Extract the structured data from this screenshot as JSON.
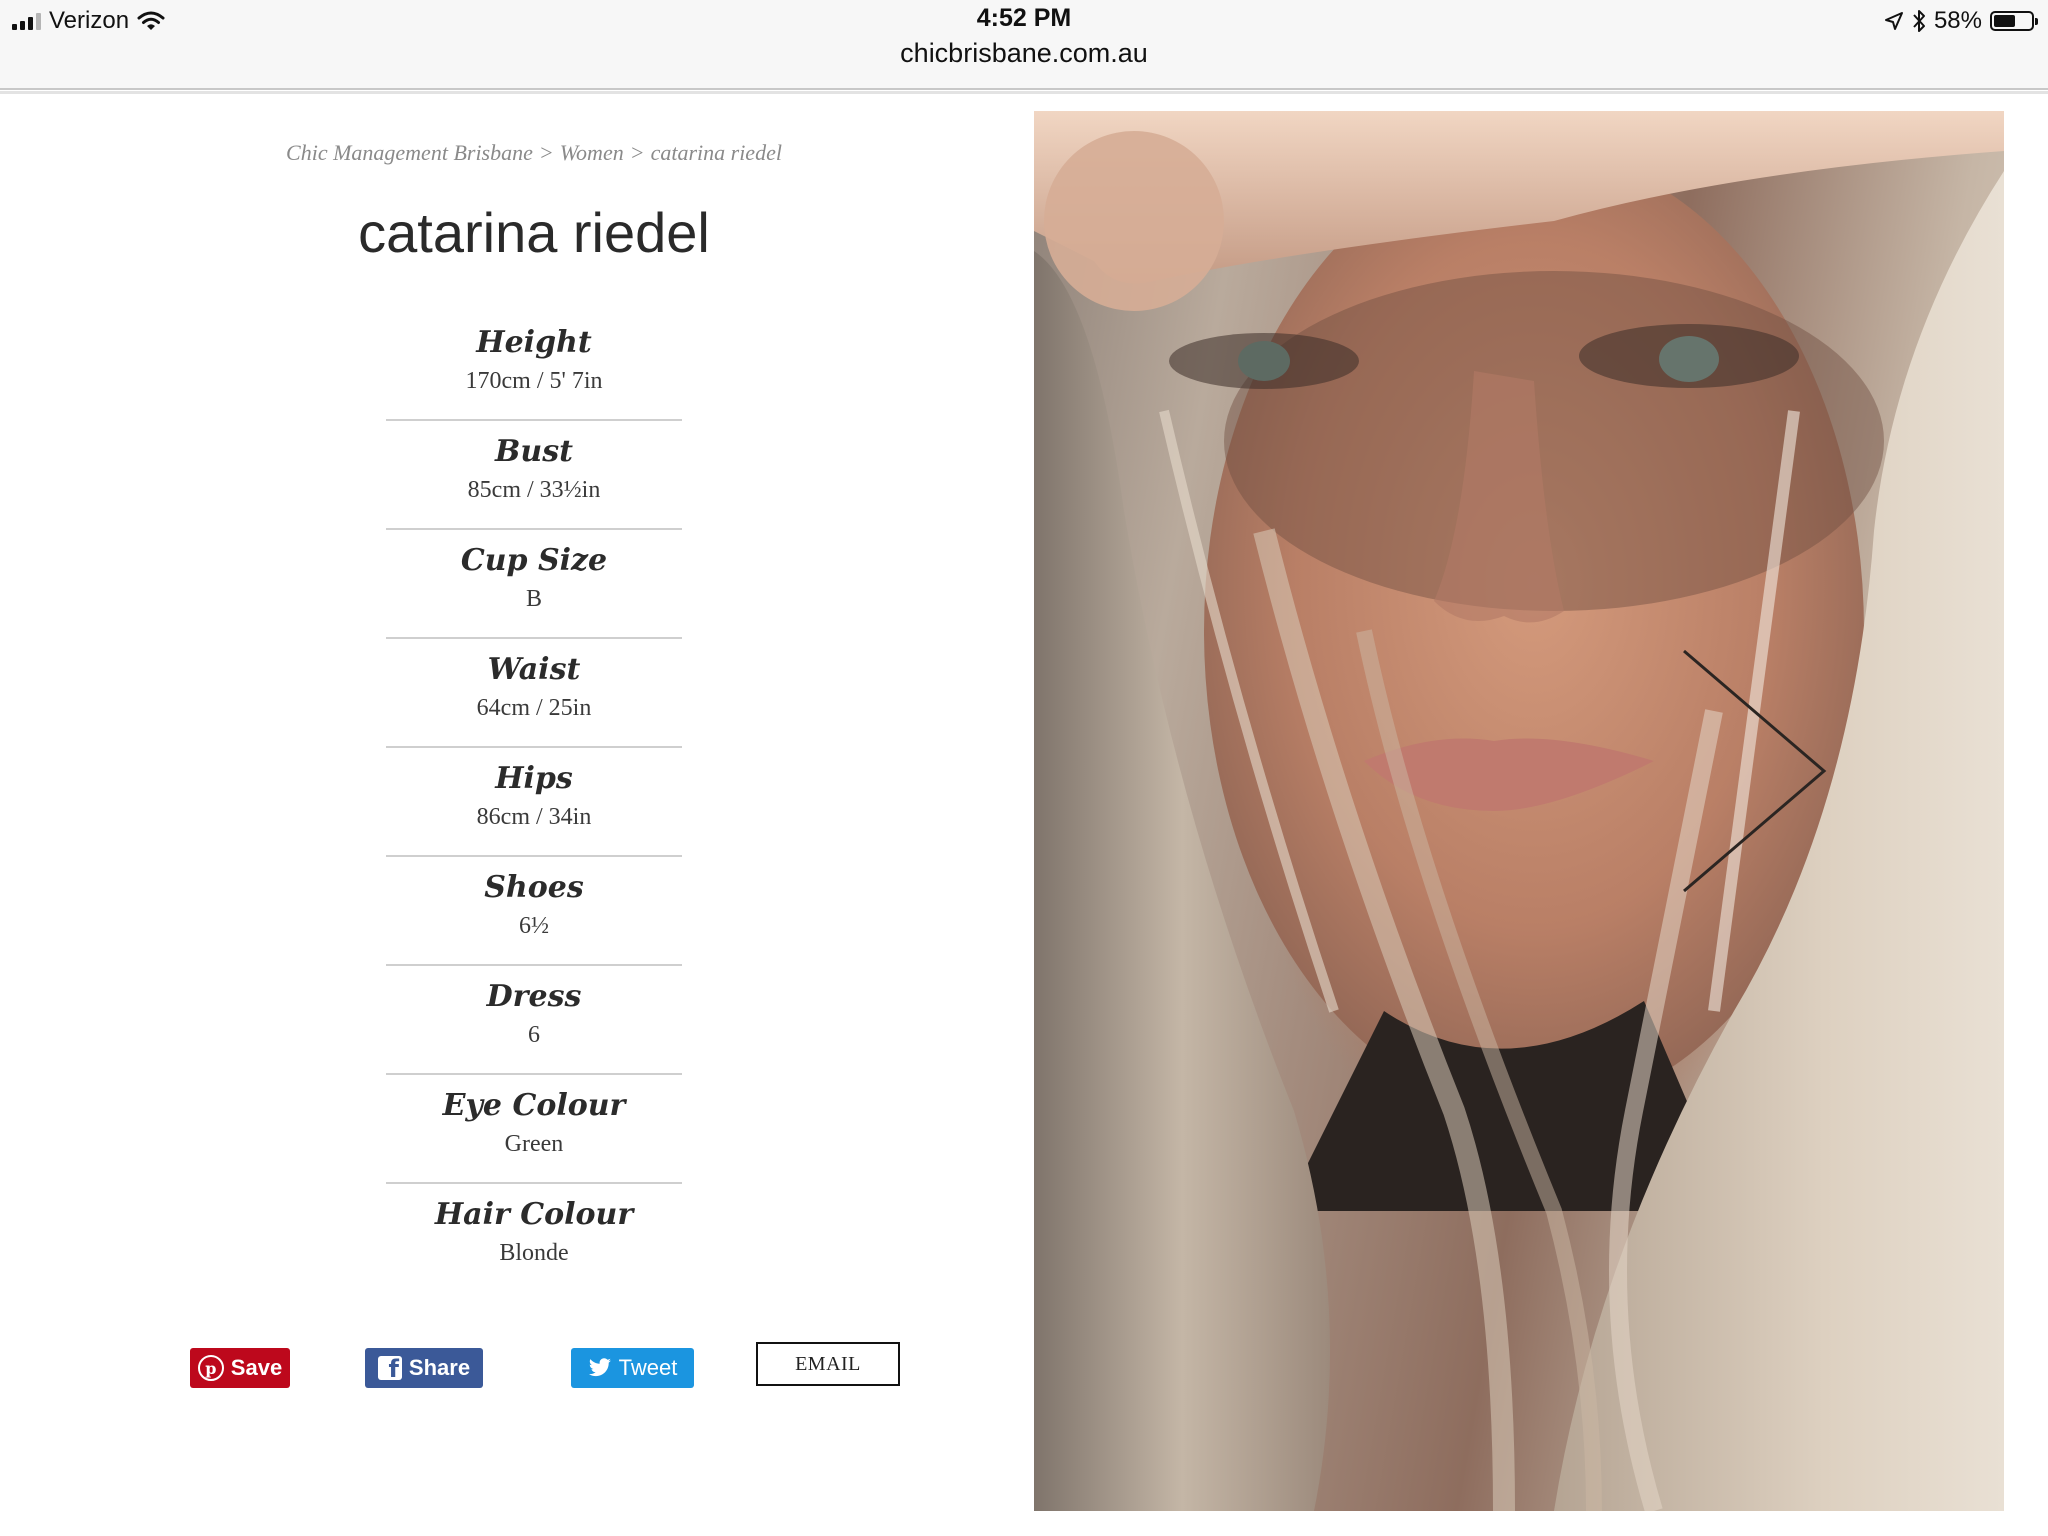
{
  "status_bar": {
    "carrier": "Verizon",
    "time": "4:52 PM",
    "battery_pct": "58%",
    "battery_level": 0.58,
    "icons": [
      "signal-icon",
      "wifi-icon",
      "location-icon",
      "bluetooth-icon",
      "battery-icon"
    ]
  },
  "address_bar": {
    "url": "chicbrisbane.com.au"
  },
  "breadcrumb": {
    "items": [
      "Chic Management Brisbane",
      "Women",
      "catarina riedel"
    ],
    "separator": ">"
  },
  "model": {
    "name": "catarina riedel",
    "stats": [
      {
        "label": "Height",
        "value": "170cm / 5' 7in"
      },
      {
        "label": "Bust",
        "value": "85cm / 33½in"
      },
      {
        "label": "Cup Size",
        "value": "B"
      },
      {
        "label": "Waist",
        "value": "64cm / 25in"
      },
      {
        "label": "Hips",
        "value": "86cm / 34in"
      },
      {
        "label": "Shoes",
        "value": "6½"
      },
      {
        "label": "Dress",
        "value": "6"
      },
      {
        "label": "Eye Colour",
        "value": "Green"
      },
      {
        "label": "Hair Colour",
        "value": "Blonde"
      }
    ]
  },
  "share": {
    "pinterest_label": "Save",
    "facebook_label": "Share",
    "twitter_label": "Tweet",
    "email_label": "EMAIL",
    "colors": {
      "pinterest": "#bd081c",
      "facebook": "#3b5998",
      "twitter": "#1b95e0"
    }
  },
  "photo": {
    "icon": "model-portrait-photo"
  }
}
